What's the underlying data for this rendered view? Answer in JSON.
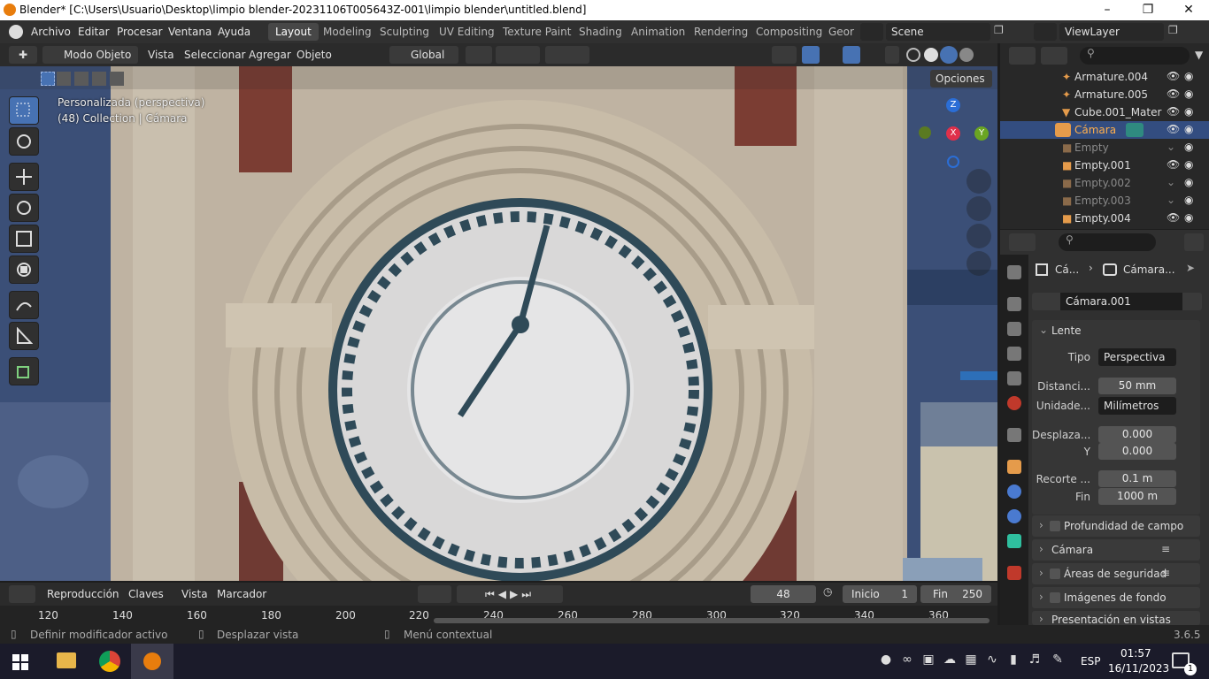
{
  "window": {
    "title": "Blender* [C:\\Users\\Usuario\\Desktop\\limpio blender-20231106T005643Z-001\\limpio blender\\untitled.blend]"
  },
  "menu": [
    "Archivo",
    "Editar",
    "Procesar",
    "Ventana",
    "Ayuda"
  ],
  "workspaces": [
    "Layout",
    "Modeling",
    "Sculpting",
    "UV Editing",
    "Texture Paint",
    "Shading",
    "Animation",
    "Rendering",
    "Compositing",
    "Geor"
  ],
  "scene": "Scene",
  "viewlayer": "ViewLayer",
  "viewport_header": {
    "mode": "Modo Objeto",
    "menus": [
      "Vista",
      "Seleccionar",
      "Agregar",
      "Objeto"
    ],
    "orientation": "Global",
    "options": "Opciones"
  },
  "viewport": {
    "line1": "Personalizada (perspectiva)",
    "line2": "(48) Collection | Cámara"
  },
  "gizmo": {
    "z": "Z",
    "x": "X",
    "y": "Y"
  },
  "outliner": [
    {
      "name": "Armature.004",
      "dim": false
    },
    {
      "name": "Armature.005",
      "dim": false
    },
    {
      "name": "Cube.001_Mater",
      "dim": false
    },
    {
      "name": "Cámara",
      "dim": false,
      "selected": true
    },
    {
      "name": "Empty",
      "dim": true
    },
    {
      "name": "Empty.001",
      "dim": false
    },
    {
      "name": "Empty.002",
      "dim": true
    },
    {
      "name": "Empty.003",
      "dim": true
    },
    {
      "name": "Empty.004",
      "dim": false
    }
  ],
  "properties": {
    "breadcrumb_a": "Cá...",
    "breadcrumb_b": "Cámara...",
    "datablock": "Cámara.001",
    "lente": "Lente",
    "tipo_label": "Tipo",
    "tipo": "Perspectiva",
    "dist_label": "Distanci...",
    "dist": "50 mm",
    "unidad_label": "Unidade...",
    "unidad": "Milímetros",
    "desp_label": "Desplaza...",
    "desp_x": "0.000",
    "y_label": "Y",
    "desp_y": "0.000",
    "recorte_label": "Recorte ...",
    "recorte": "0.1 m",
    "fin_label": "Fin",
    "fin": "1000 m",
    "sections": [
      "Profundidad de campo",
      "Cámara",
      "Áreas de seguridad",
      "Imágenes de fondo",
      "Presentación en vistas"
    ]
  },
  "timeline": {
    "menus": [
      "Reproducción",
      "Claves",
      "Vista",
      "Marcador"
    ],
    "frame": "48",
    "inicio_label": "Inicio",
    "inicio": "1",
    "fin_label": "Fin",
    "fin": "250",
    "ruler": [
      "120",
      "140",
      "160",
      "180",
      "200",
      "220",
      "240",
      "260",
      "280",
      "300",
      "320",
      "340",
      "360"
    ]
  },
  "status": {
    "a": "Definir modificador activo",
    "b": "Desplazar vista",
    "c": "Menú contextual",
    "version": "3.6.5"
  },
  "taskbar": {
    "lang": "ESP",
    "time": "01:57",
    "date": "16/11/2023",
    "notif": "1"
  }
}
